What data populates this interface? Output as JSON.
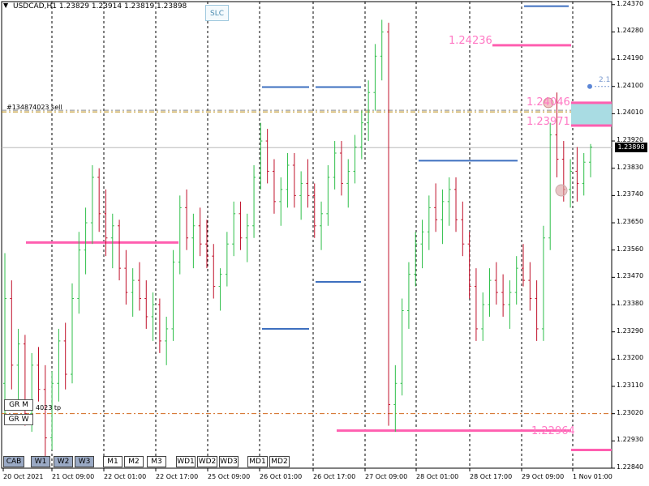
{
  "header": {
    "symbol_line": "USDCAD,H1  1.23829 1.23914 1.23819 1.23898",
    "arrow": "▼"
  },
  "buttons": {
    "slc": "SLC",
    "gr_m": "GR M",
    "gr_w": "GR W",
    "timeframes": [
      "CAB",
      "W1",
      "W2",
      "W3",
      "M1",
      "M2",
      "M3",
      "WD1",
      "WD2",
      "WD3",
      "MD1",
      "MD2"
    ],
    "active": [
      "CAB",
      "W1",
      "W2",
      "W3"
    ]
  },
  "annotations": {
    "order_label": "#134874023 sell",
    "tp_label": "4023 tp",
    "level_top": "1.24236",
    "level_mid1": "1.24046",
    "level_mid2": "1.23971",
    "level_bottom": "1.22964",
    "small_tag": "2.1"
  },
  "colors": {
    "bull": "#2fbf4a",
    "bear": "#c0102a",
    "zone_line": "#ff5fb0",
    "blue_level": "#3d6fbf",
    "order_line": "#b8860b",
    "tp_line": "#d2691e",
    "zone_fill": "#a9dce3"
  },
  "chart_data": {
    "type": "candlestick",
    "symbol": "USDCAD",
    "timeframe": "H1",
    "ohlc_current": {
      "open": 1.23829,
      "high": 1.23914,
      "low": 1.23819,
      "close": 1.23898
    },
    "current_price": "1.23898",
    "ylim": [
      1.2284,
      1.2438
    ],
    "y_ticks": [
      "1.24370",
      "1.24280",
      "1.24190",
      "1.24100",
      "1.24010",
      "1.23920",
      "1.23830",
      "1.23740",
      "1.23650",
      "1.23560",
      "1.23470",
      "1.23380",
      "1.23290",
      "1.23200",
      "1.23110",
      "1.23020",
      "1.22930",
      "1.22840"
    ],
    "x_ticks": [
      "20 Oct 2021",
      "21 Oct 09:00",
      "22 Oct 01:00",
      "22 Oct 17:00",
      "25 Oct 09:00",
      "26 Oct 01:00",
      "26 Oct 17:00",
      "27 Oct 09:00",
      "28 Oct 01:00",
      "28 Oct 17:00",
      "29 Oct 09:00",
      "1 Nov 01:00"
    ],
    "levels": {
      "pink_top": 1.24236,
      "pink_left": 1.23585,
      "pink_bottom": 1.22964,
      "pink_bottom_right": 1.229,
      "zone_high": 1.24046,
      "zone_low": 1.23971,
      "order_sell": 1.24016,
      "tp": 1.2302,
      "grey_price": 1.23898
    },
    "blue_segments": [
      {
        "price": 1.24365,
        "from": "29 Oct 09:00",
        "to": "1 Nov 01:00"
      },
      {
        "price": 1.24098,
        "from": "26 Oct 01:00",
        "to": "26 Oct 17:00"
      },
      {
        "price": 1.24098,
        "from": "26 Oct 17:00",
        "to": "27 Oct 09:00"
      },
      {
        "price": 1.23855,
        "from": "28 Oct 01:00",
        "to": "29 Oct 09:00"
      },
      {
        "price": 1.23455,
        "from": "26 Oct 17:00",
        "to": "27 Oct 09:00"
      },
      {
        "price": 1.233,
        "from": "26 Oct 01:00",
        "to": "26 Oct 17:00"
      }
    ],
    "candles": [
      [
        1.2312,
        1.2355,
        1.23,
        1.234
      ],
      [
        1.234,
        1.2346,
        1.231,
        1.2318
      ],
      [
        1.2318,
        1.233,
        1.2305,
        1.2325
      ],
      [
        1.2325,
        1.2328,
        1.2298,
        1.2302
      ],
      [
        1.2302,
        1.2322,
        1.2296,
        1.2318
      ],
      [
        1.2318,
        1.2324,
        1.2306,
        1.231
      ],
      [
        1.231,
        1.2318,
        1.2288,
        1.2294
      ],
      [
        1.2294,
        1.2316,
        1.229,
        1.2312
      ],
      [
        1.2312,
        1.233,
        1.2306,
        1.2326
      ],
      [
        1.2326,
        1.2332,
        1.231,
        1.2315
      ],
      [
        1.2315,
        1.2345,
        1.2312,
        1.234
      ],
      [
        1.234,
        1.2362,
        1.2335,
        1.2356
      ],
      [
        1.2356,
        1.237,
        1.2348,
        1.2365
      ],
      [
        1.2365,
        1.2384,
        1.2358,
        1.238
      ],
      [
        1.238,
        1.2383,
        1.2362,
        1.2368
      ],
      [
        1.2368,
        1.2376,
        1.2354,
        1.236
      ],
      [
        1.236,
        1.2368,
        1.235,
        1.2364
      ],
      [
        1.2364,
        1.2366,
        1.2346,
        1.235
      ],
      [
        1.235,
        1.2356,
        1.2338,
        1.2342
      ],
      [
        1.2342,
        1.235,
        1.2334,
        1.2346
      ],
      [
        1.2346,
        1.2352,
        1.2336,
        1.234
      ],
      [
        1.234,
        1.2346,
        1.233,
        1.2334
      ],
      [
        1.2334,
        1.2342,
        1.2326,
        1.2338
      ],
      [
        1.2338,
        1.234,
        1.2322,
        1.2326
      ],
      [
        1.2326,
        1.2334,
        1.2318,
        1.233
      ],
      [
        1.233,
        1.2356,
        1.2326,
        1.2352
      ],
      [
        1.2352,
        1.2374,
        1.2348,
        1.237
      ],
      [
        1.237,
        1.2376,
        1.2356,
        1.236
      ],
      [
        1.236,
        1.2368,
        1.235,
        1.2364
      ],
      [
        1.2364,
        1.237,
        1.2354,
        1.2358
      ],
      [
        1.2358,
        1.2366,
        1.235,
        1.2354
      ],
      [
        1.2354,
        1.2358,
        1.234,
        1.2344
      ],
      [
        1.2344,
        1.235,
        1.2336,
        1.2348
      ],
      [
        1.2348,
        1.2362,
        1.2344,
        1.2358
      ],
      [
        1.2358,
        1.2372,
        1.2354,
        1.2368
      ],
      [
        1.2368,
        1.2372,
        1.2356,
        1.236
      ],
      [
        1.236,
        1.2368,
        1.2352,
        1.2364
      ],
      [
        1.2364,
        1.2384,
        1.236,
        1.238
      ],
      [
        1.238,
        1.2398,
        1.2376,
        1.2392
      ],
      [
        1.2392,
        1.2396,
        1.2378,
        1.2382
      ],
      [
        1.2382,
        1.2386,
        1.2368,
        1.2372
      ],
      [
        1.2372,
        1.238,
        1.2364,
        1.2376
      ],
      [
        1.2376,
        1.2388,
        1.237,
        1.2384
      ],
      [
        1.2384,
        1.2388,
        1.237,
        1.2374
      ],
      [
        1.2374,
        1.2382,
        1.2366,
        1.2378
      ],
      [
        1.2378,
        1.2386,
        1.237,
        1.2374
      ],
      [
        1.2374,
        1.2378,
        1.236,
        1.2364
      ],
      [
        1.2364,
        1.2372,
        1.2356,
        1.2368
      ],
      [
        1.2368,
        1.2384,
        1.2364,
        1.238
      ],
      [
        1.238,
        1.2392,
        1.2376,
        1.2388
      ],
      [
        1.2388,
        1.2392,
        1.2374,
        1.2378
      ],
      [
        1.2378,
        1.2386,
        1.237,
        1.2382
      ],
      [
        1.2382,
        1.2394,
        1.2378,
        1.239
      ],
      [
        1.239,
        1.2402,
        1.2386,
        1.2398
      ],
      [
        1.2398,
        1.2412,
        1.2392,
        1.2408
      ],
      [
        1.2408,
        1.2424,
        1.2402,
        1.242
      ],
      [
        1.242,
        1.2432,
        1.2412,
        1.2428
      ],
      [
        1.2428,
        1.2431,
        1.2298,
        1.2305
      ],
      [
        1.2305,
        1.2318,
        1.2296,
        1.2312
      ],
      [
        1.2312,
        1.234,
        1.2308,
        1.2336
      ],
      [
        1.2336,
        1.2352,
        1.233,
        1.2348
      ],
      [
        1.2348,
        1.2362,
        1.2344,
        1.2358
      ],
      [
        1.2358,
        1.2366,
        1.235,
        1.2362
      ],
      [
        1.2362,
        1.2374,
        1.2356,
        1.237
      ],
      [
        1.237,
        1.2378,
        1.2362,
        1.2366
      ],
      [
        1.2366,
        1.2376,
        1.2358,
        1.2372
      ],
      [
        1.2372,
        1.238,
        1.2364,
        1.2376
      ],
      [
        1.2376,
        1.238,
        1.2362,
        1.2366
      ],
      [
        1.2366,
        1.2372,
        1.2354,
        1.2358
      ],
      [
        1.2358,
        1.2362,
        1.234,
        1.2344
      ],
      [
        1.2344,
        1.235,
        1.2326,
        1.233
      ],
      [
        1.233,
        1.2342,
        1.2326,
        1.2338
      ],
      [
        1.2338,
        1.235,
        1.2334,
        1.2346
      ],
      [
        1.2346,
        1.2352,
        1.2338,
        1.2342
      ],
      [
        1.2342,
        1.2348,
        1.2334,
        1.2338
      ],
      [
        1.2338,
        1.2346,
        1.233,
        1.2342
      ],
      [
        1.2342,
        1.2354,
        1.2338,
        1.235
      ],
      [
        1.235,
        1.2358,
        1.2344,
        1.2346
      ],
      [
        1.2346,
        1.2352,
        1.2336,
        1.234
      ],
      [
        1.234,
        1.2346,
        1.2326,
        1.233
      ],
      [
        1.233,
        1.2364,
        1.2326,
        1.236
      ],
      [
        1.236,
        1.2398,
        1.2356,
        1.2394
      ],
      [
        1.2394,
        1.2408,
        1.238,
        1.2386
      ],
      [
        1.2386,
        1.2392,
        1.2372,
        1.2376
      ],
      [
        1.2376,
        1.2386,
        1.237,
        1.2382
      ],
      [
        1.2382,
        1.239,
        1.2372,
        1.2378
      ],
      [
        1.2378,
        1.2388,
        1.2374,
        1.2385
      ],
      [
        1.2385,
        1.2391,
        1.238,
        1.239
      ]
    ]
  }
}
